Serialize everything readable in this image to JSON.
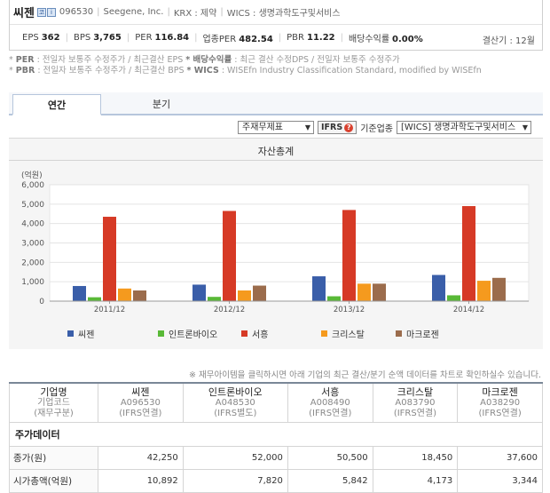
{
  "company": {
    "name": "씨젠",
    "code": "096530",
    "eng_name": "Seegene, Inc.",
    "krx": "KRX : 제약",
    "wics": "WICS : 생명과학도구및서비스"
  },
  "metrics": [
    {
      "label": "EPS",
      "value": "362"
    },
    {
      "label": "BPS",
      "value": "3,765"
    },
    {
      "label": "PER",
      "value": "116.84"
    },
    {
      "label": "업종PER",
      "value": "482.54"
    },
    {
      "label": "PBR",
      "value": "11.22"
    },
    {
      "label": "배당수익률",
      "value": "0.00%"
    }
  ],
  "settlement": "결산기 : 12월",
  "notes": {
    "line1_prefix": "* ",
    "per_b": "PER",
    "per_text": " : 전일자 보통주 수정주가 / 최근결산 EPS ",
    "div_b": "* 배당수익률",
    "div_text": " : 최근 결산 수정DPS / 전일자 보통주 수정주가",
    "pbr_b": "PBR",
    "pbr_text": " : 전일자 보통주 수정주가 / 최근결산 BPS ",
    "wics_b": "* WICS",
    "wics_text": " : WISEfn Industry Classification Standard, modified by WISEfn"
  },
  "tabs": {
    "annual": "연간",
    "quarter": "분기"
  },
  "controls": {
    "item_select": "주재무제표",
    "ifrs": "IFRS",
    "ifrs_help": "?",
    "industry_label": "기준업종",
    "industry_select": "[WICS] 생명과학도구및서비스"
  },
  "chart_data": {
    "type": "bar",
    "title": "자산총계",
    "ylabel": "(억원)",
    "categories": [
      "2011/12",
      "2012/12",
      "2013/12",
      "2014/12"
    ],
    "ylim": [
      0,
      6000
    ],
    "yticks": [
      "0",
      "1,000",
      "2,000",
      "3,000",
      "4,000",
      "5,000",
      "6,000"
    ],
    "series": [
      {
        "name": "씨젠",
        "color": "#3a5ea9",
        "values": [
          780,
          850,
          1280,
          1350
        ]
      },
      {
        "name": "인트론바이오",
        "color": "#59b937",
        "values": [
          200,
          220,
          250,
          300
        ]
      },
      {
        "name": "서흥",
        "color": "#d63a26",
        "values": [
          4350,
          4650,
          4700,
          4900
        ]
      },
      {
        "name": "크리스탈",
        "color": "#f59a1e",
        "values": [
          650,
          550,
          900,
          1050
        ]
      },
      {
        "name": "마크로젠",
        "color": "#9b6c4c",
        "values": [
          550,
          800,
          900,
          1200
        ]
      }
    ]
  },
  "hint": "※ 재무아이템을 클릭하시면 아래 기업의 최근 결산/분기 순액 데이터를 차트로 확인하실수 있습니다.",
  "table": {
    "header_label": {
      "name": "기업명",
      "code": "기업코드",
      "type": "(재무구분)"
    },
    "companies": [
      {
        "name": "씨젠",
        "code": "A096530",
        "type": "(IFRS연결)"
      },
      {
        "name": "인트론바이오",
        "code": "A048530",
        "type": "(IFRS별도)"
      },
      {
        "name": "서흥",
        "code": "A008490",
        "type": "(IFRS연결)"
      },
      {
        "name": "크리스탈",
        "code": "A083790",
        "type": "(IFRS연결)"
      },
      {
        "name": "마크로젠",
        "code": "A038290",
        "type": "(IFRS연결)"
      }
    ],
    "section": "주가데이터",
    "rows": [
      {
        "label": "종가(원)",
        "values": [
          "42,250",
          "52,000",
          "50,500",
          "18,450",
          "37,600"
        ]
      },
      {
        "label": "시가총액(억원)",
        "values": [
          "10,892",
          "7,820",
          "5,842",
          "4,173",
          "3,344"
        ]
      }
    ]
  }
}
